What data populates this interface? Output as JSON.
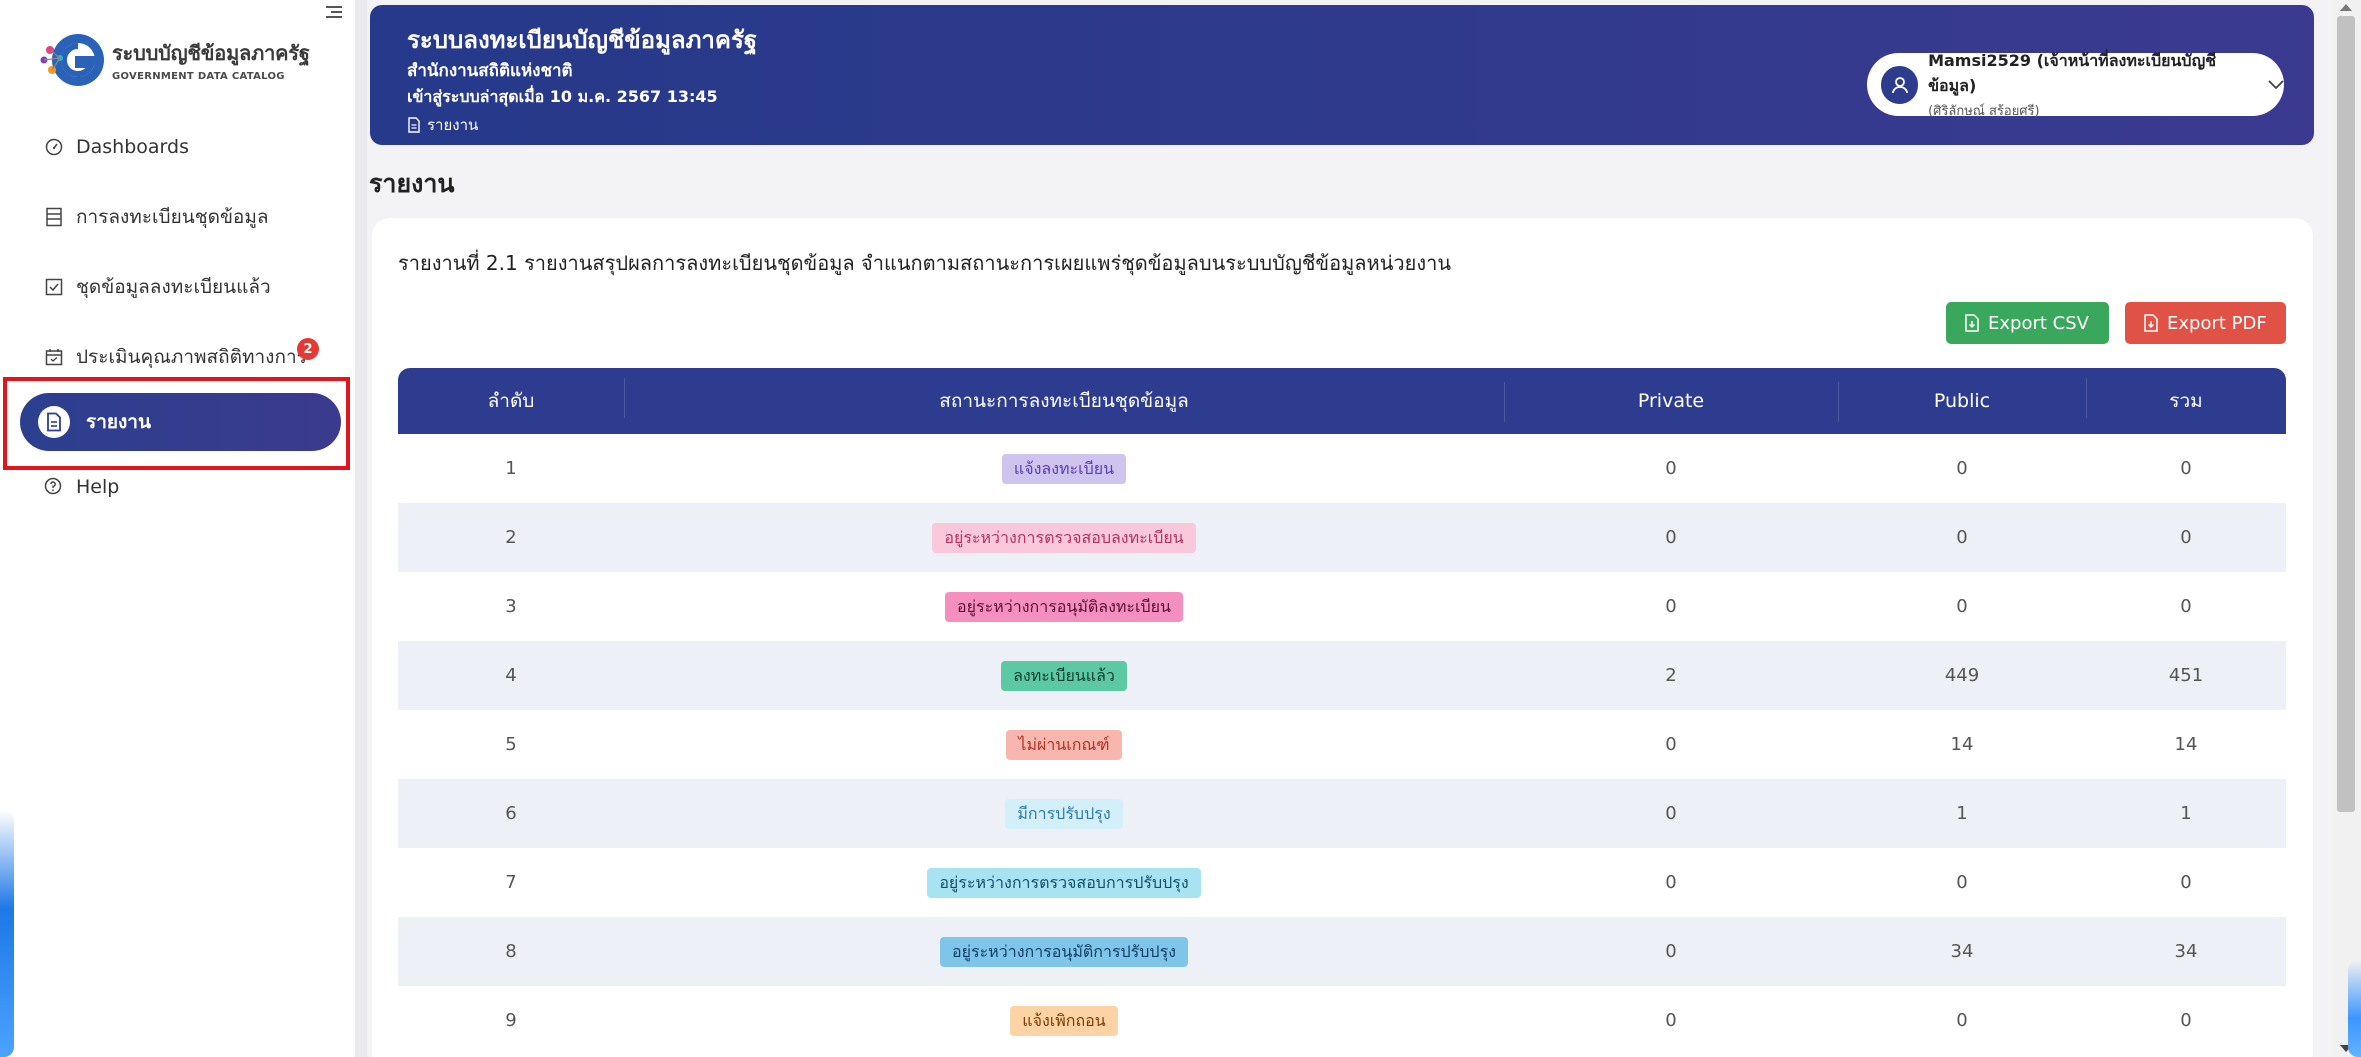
{
  "sidebar": {
    "brand_title": "ระบบบัญชีข้อมูลภาครัฐ",
    "brand_subtitle": "GOVERNMENT DATA CATALOG",
    "items": [
      {
        "label": "Dashboards",
        "icon": "gauge-icon"
      },
      {
        "label": "การลงทะเบียนชุดข้อมูล",
        "icon": "form-icon"
      },
      {
        "label": "ชุดข้อมูลลงทะเบียนแล้ว",
        "icon": "checkbox-icon"
      },
      {
        "label": "ประเมินคุณภาพสถิติทางการ",
        "icon": "calendar-check-icon",
        "badge": "2"
      }
    ],
    "active_item": {
      "label": "รายงาน",
      "icon": "report-icon"
    },
    "help_label": "Help"
  },
  "header": {
    "title": "ระบบลงทะเบียนบัญชีข้อมูลภาครัฐ",
    "organization": "สำนักงานสถิติแห่งชาติ",
    "last_login": "เข้าสู่ระบบล่าสุดเมื่อ 10 ม.ค. 2567 13:45",
    "breadcrumb": "รายงาน"
  },
  "user": {
    "name": "Mamsi2529 (เจ้าหน้าที่ลงทะเบียนบัญชีข้อมูล)",
    "fullname": "(ศิริลักษณ์ สร้อยศรี)"
  },
  "page_title": "รายงาน",
  "report": {
    "title": "รายงานที่ 2.1 รายงานสรุปผลการลงทะเบียนชุดข้อมูล จำแนกตามสถานะการเผยแพร่ชุดข้อมูลบนระบบบัญชีข้อมูลหน่วยงาน",
    "export_csv": "Export CSV",
    "export_pdf": "Export PDF"
  },
  "table": {
    "headers": [
      "ลำดับ",
      "สถานะการลงทะเบียนชุดข้อมูล",
      "Private",
      "Public",
      "รวม"
    ],
    "rows": [
      {
        "no": "1",
        "status": "แจ้งลงทะเบียน",
        "private": "0",
        "public": "0",
        "total": "0",
        "bg": "#cfc3f0",
        "fg": "#5b3fb0"
      },
      {
        "no": "2",
        "status": "อยู่ระหว่างการตรวจสอบลงทะเบียน",
        "private": "0",
        "public": "0",
        "total": "0",
        "bg": "#f9c8da",
        "fg": "#b0345f"
      },
      {
        "no": "3",
        "status": "อยู่ระหว่างการอนุมัติลงทะเบียน",
        "private": "0",
        "public": "0",
        "total": "0",
        "bg": "#f48fbf",
        "fg": "#5a0f35"
      },
      {
        "no": "4",
        "status": "ลงทะเบียนแล้ว",
        "private": "2",
        "public": "449",
        "total": "451",
        "bg": "#5cc8a4",
        "fg": "#0f3f30"
      },
      {
        "no": "5",
        "status": "ไม่ผ่านเกณฑ์",
        "private": "0",
        "public": "14",
        "total": "14",
        "bg": "#f8b7ae",
        "fg": "#b03326"
      },
      {
        "no": "6",
        "status": "มีการปรับปรุง",
        "private": "0",
        "public": "1",
        "total": "1",
        "bg": "#d3f0fa",
        "fg": "#2d7aa5"
      },
      {
        "no": "7",
        "status": "อยู่ระหว่างการตรวจสอบการปรับปรุง",
        "private": "0",
        "public": "0",
        "total": "0",
        "bg": "#a8e3f4",
        "fg": "#0f4f68"
      },
      {
        "no": "8",
        "status": "อยู่ระหว่างการอนุมัติการปรับปรุง",
        "private": "0",
        "public": "34",
        "total": "34",
        "bg": "#7fc5ea",
        "fg": "#0f3f62"
      },
      {
        "no": "9",
        "status": "แจ้งเพิกถอน",
        "private": "0",
        "public": "0",
        "total": "0",
        "bg": "#fcd3a4",
        "fg": "#7a3d05"
      }
    ]
  },
  "colors": {
    "primary": "#2d3c8f",
    "csv": "#3aa85c",
    "pdf": "#e05246",
    "highlight": "#e3141b"
  }
}
